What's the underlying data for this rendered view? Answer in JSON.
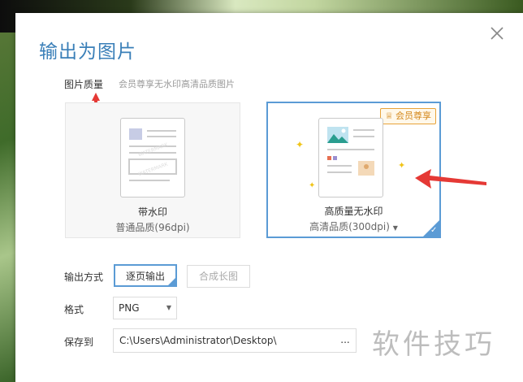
{
  "dialog": {
    "title": "输出为图片",
    "close_icon": "close-icon"
  },
  "quality": {
    "label": "图片质量",
    "hint": "会员尊享无水印高清品质图片",
    "options": [
      {
        "title": "带水印",
        "subtitle": "普通品质(96dpi)"
      },
      {
        "title": "高质量无水印",
        "subtitle": "高清品质(300dpi)",
        "badge": "会员尊享",
        "selected": true
      }
    ]
  },
  "output_mode": {
    "label": "输出方式",
    "options": [
      "逐页输出",
      "合成长图"
    ],
    "selected": "逐页输出"
  },
  "format": {
    "label": "格式",
    "value": "PNG"
  },
  "save_to": {
    "label": "保存到",
    "path": "C:\\Users\\Administrator\\Desktop\\",
    "browse_label": "..."
  },
  "watermark_text": "软件技巧",
  "colors": {
    "accent": "#5b9bd5",
    "title": "#3a7fb8",
    "badge": "#e8a33a",
    "annotation_arrow": "#e53935"
  }
}
